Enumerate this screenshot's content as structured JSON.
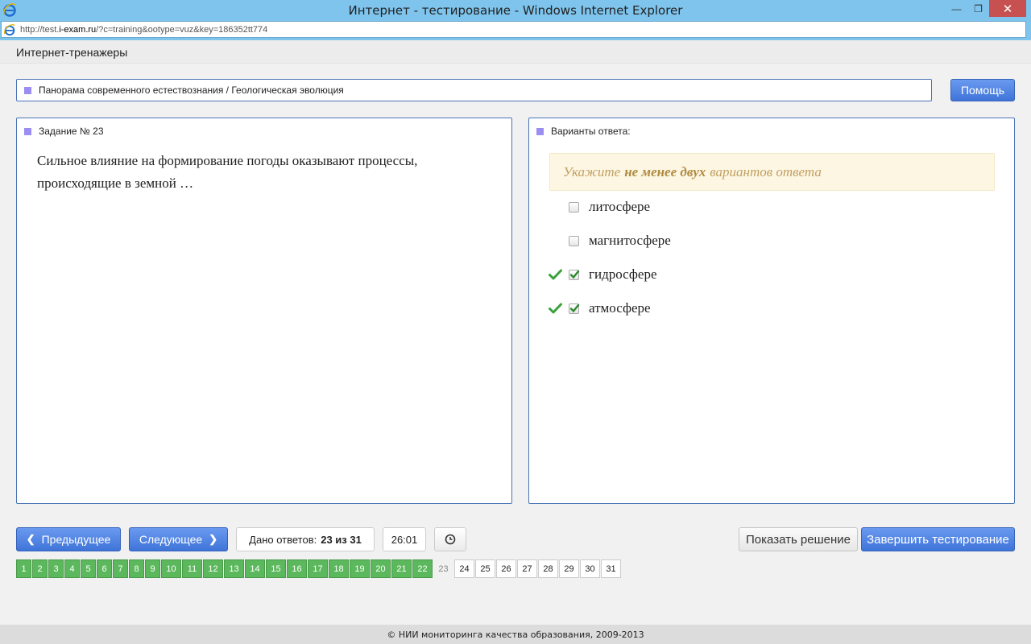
{
  "window": {
    "title": "Интернет - тестирование - Windows Internet Explorer",
    "minimize_glyph": "—",
    "restore_glyph": "❐",
    "close_glyph": "✕"
  },
  "address": {
    "url_prefix": "http://test.",
    "url_domain": "i-exam.ru",
    "url_rest": "/?c=training&ootype=vuz&key=186352tt774"
  },
  "header": {
    "app_name": "Интернет-тренажеры"
  },
  "breadcrumb": {
    "text": "Панорама современного естествознания / Геологическая эволюция"
  },
  "help_button": "Помощь",
  "task": {
    "heading": "Задание № 23",
    "text": "Сильное влияние на формирование погоды оказывают процессы, происходящие в земной …"
  },
  "answers": {
    "heading": "Варианты ответа:",
    "hint_before": "Укажите",
    "hint_bold": "не менее двух",
    "hint_after": "вариантов ответа",
    "options": [
      {
        "label": "литосфере",
        "checked": false,
        "correct": false
      },
      {
        "label": "магнитосфере",
        "checked": false,
        "correct": false
      },
      {
        "label": "гидросфере",
        "checked": true,
        "correct": true
      },
      {
        "label": "атмосфере",
        "checked": true,
        "correct": true
      }
    ]
  },
  "controls": {
    "prev": "Предыдущее",
    "next": "Следующее",
    "answered_label": "Дано ответов:",
    "answered_value": "23 из 31",
    "timer": "26:01",
    "show_solution": "Показать решение",
    "finish": "Завершить тестирование"
  },
  "pages": {
    "numbers": [
      "1",
      "2",
      "3",
      "4",
      "5",
      "6",
      "7",
      "8",
      "9",
      "10",
      "11",
      "12",
      "13",
      "14",
      "15",
      "16",
      "17",
      "18",
      "19",
      "20",
      "21",
      "22",
      "23",
      "24",
      "25",
      "26",
      "27",
      "28",
      "29",
      "30",
      "31"
    ],
    "done_count": 22,
    "current": "23"
  },
  "footer": "© НИИ мониторинга качества образования, 2009-2013",
  "colors": {
    "accent": "#4a74b6",
    "done": "#5cb85c",
    "marker": "#9b8ef2",
    "titlebar": "#7ec4ec"
  }
}
